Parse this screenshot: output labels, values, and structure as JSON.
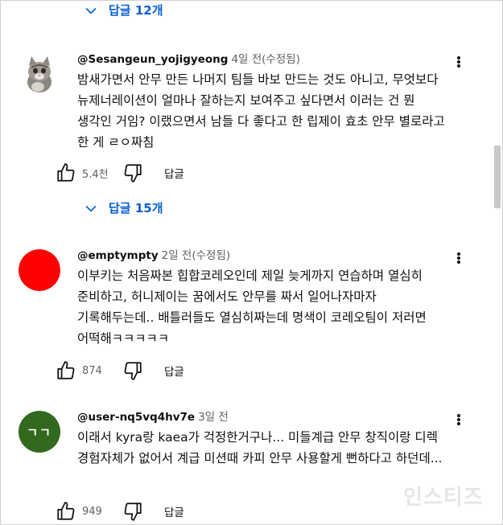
{
  "reply_toggles": [
    {
      "label": "답글 12개"
    },
    {
      "label": "답글 15개"
    }
  ],
  "comments": [
    {
      "author": "@Sesangeun_yojigyeong",
      "time": "4일 전(수정됨)",
      "avatar_type": "kitten-photo",
      "text": "밤새가면서 안무 만든 나머지 팀들 바보 만드는 것도 아니고, 무엇보다 뉴제너레이션이 얼마나 잘하는지 보여주고 싶다면서 이러는 건 뭔 생각인 거임? 이랬으면서 남들 다 좋다고 한 립제이 효초 안무 별로라고 한 게 ㄹㅇ짜침",
      "likes": "5.4천",
      "reply_label": "답글"
    },
    {
      "author": "@emptympty",
      "time": "2일 전(수정됨)",
      "avatar_type": "red-circle",
      "avatar_color": "#ff0000",
      "text": "이부키는 처음짜본 힙합코레오인데 제일 늦게까지 연습하며 열심히 준비하고, 허니제이는 꿈에서도 안무를 짜서 일어나자마자 기록해두는데.. 배틀러들도 열심히짜는데 명색이 코레오팀이 저러면 어떡해ㅋㅋㅋㅋㅋ",
      "likes": "874",
      "reply_label": "답글"
    },
    {
      "author": "@user-nq5vq4hv7e",
      "time": "3일 전",
      "avatar_type": "letter",
      "avatar_color": "#33691e",
      "avatar_letter": "ㄱㄱ",
      "text": "이래서 kyra랑 kaea가 걱정한거구나... 미들계급 안무 창직이랑 디렉 경험자체가 없어서 계급 미션때 카피 안무 사용할게 뻔하다고 하던데...",
      "likes": "949",
      "reply_label": "답글"
    }
  ],
  "watermark": "인스티즈",
  "colors": {
    "accent": "#065fd4",
    "text": "#0f0f0f",
    "secondary": "#606060"
  }
}
